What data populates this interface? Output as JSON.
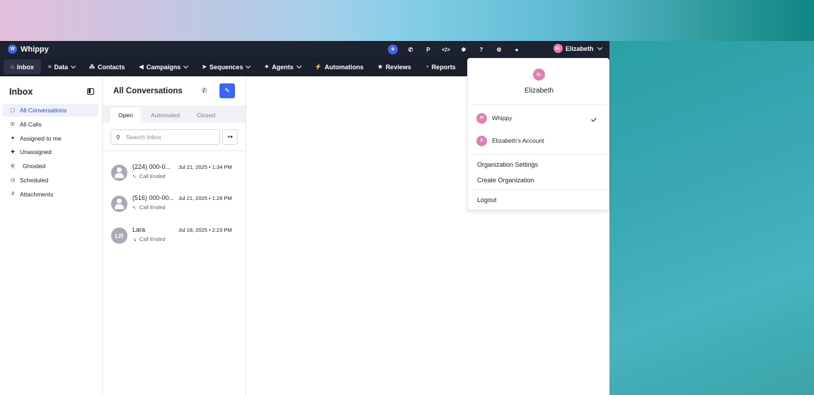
{
  "brand": {
    "name": "Whippy",
    "logo_letter": "W"
  },
  "topbar": {
    "icons": [
      "plus-icon",
      "phone-icon",
      "p-icon",
      "code-icon",
      "puzzle-icon",
      "help-icon",
      "gear-icon",
      "bell-icon"
    ],
    "icon_glyphs": [
      "+",
      "✆",
      "P",
      "</>",
      "✱",
      "?",
      "⚙",
      "●"
    ],
    "user": {
      "initials": "EL",
      "name": "Elizabeth"
    }
  },
  "nav": {
    "items": [
      {
        "label": "Inbox",
        "icon": "⌂",
        "dropdown": false,
        "active": true
      },
      {
        "label": "Data",
        "icon": "≡",
        "dropdown": true
      },
      {
        "label": "Contacts",
        "icon": "⁂",
        "dropdown": false
      },
      {
        "label": "Campaigns",
        "icon": "◀",
        "dropdown": true
      },
      {
        "label": "Sequences",
        "icon": "➤",
        "dropdown": true
      },
      {
        "label": "Agents",
        "icon": "✦",
        "dropdown": true
      },
      {
        "label": "Automations",
        "icon": "⚡",
        "dropdown": false
      },
      {
        "label": "Reviews",
        "icon": "★",
        "dropdown": false
      },
      {
        "label": "Reports",
        "icon": "◔",
        "dropdown": false
      }
    ]
  },
  "sidebar": {
    "title": "Inbox",
    "items": [
      {
        "label": "All Conversations",
        "icon": "▢",
        "active": true
      },
      {
        "label": "All Calls",
        "icon": "✆"
      },
      {
        "label": "Assigned to me",
        "icon": "●"
      },
      {
        "label": "Unassigned",
        "icon": "✚"
      },
      {
        "label": "Ghosted",
        "icon": "👻"
      },
      {
        "label": "Scheduled",
        "icon": "◷"
      },
      {
        "label": "Attachments",
        "icon": "∂"
      }
    ]
  },
  "conversations": {
    "title": "All Conversations",
    "tabs": [
      "Open",
      "Automated",
      "Closed"
    ],
    "search_placeholder": "Search Inbox",
    "items": [
      {
        "name": "(224) 000-0...",
        "date": "Jul 21, 2025 • 1:34 PM",
        "status": "Call Ended",
        "direction": "↖",
        "avatar": ""
      },
      {
        "name": "(516) 000-00...",
        "date": "Jul 21, 2025 • 1:28 PM",
        "status": "Call Ended",
        "direction": "↖",
        "avatar": ""
      },
      {
        "name": "Lara",
        "date": "Jul 18, 2025 • 2:23 PM",
        "status": "Call Ended",
        "direction": "↘",
        "avatar": "LR"
      }
    ]
  },
  "dropdown": {
    "avatar_initials": "EL",
    "user_name": "Elizabeth",
    "orgs": [
      {
        "initial": "W",
        "label": "Whippy",
        "selected": true
      },
      {
        "initial": "E",
        "label": "Elizabeth's Account",
        "selected": false
      }
    ],
    "links": [
      "Organization Settings",
      "Create Organization"
    ],
    "logout": "Logout"
  },
  "colors": {
    "accent": "#3b66f5",
    "topbar": "#1d2230",
    "avatar_pink": "#e57fb3"
  }
}
